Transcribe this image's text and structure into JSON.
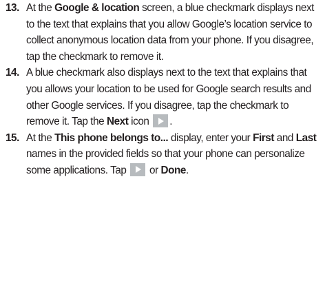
{
  "steps": [
    {
      "number": "13.",
      "t1": "At the ",
      "b1": "Google & location",
      "t2": " screen, a blue checkmark displays next to the text that explains that you allow Google’s location service to collect anonymous location data from your phone. If you disagree, tap the checkmark to remove it."
    },
    {
      "number": "14.",
      "t1": "A blue checkmark also displays next to the text that explains that you allows your location to be used for Google search results and other Google services. If you disagree, tap the checkmark to remove it. Tap the ",
      "b1": "Next",
      "t2": " icon",
      "t3": "."
    },
    {
      "number": "15.",
      "t1": "At the ",
      "b1": "This phone belongs to...",
      "t2": " display, enter your ",
      "b2": "First",
      "t3": " and ",
      "b3": "Last",
      "t4": " names in the provided fields so that your phone can personalize some applications. Tap ",
      "t5": " or ",
      "b4": "Done",
      "t6": "."
    }
  ],
  "icons": {
    "next": "next-arrow-icon"
  }
}
